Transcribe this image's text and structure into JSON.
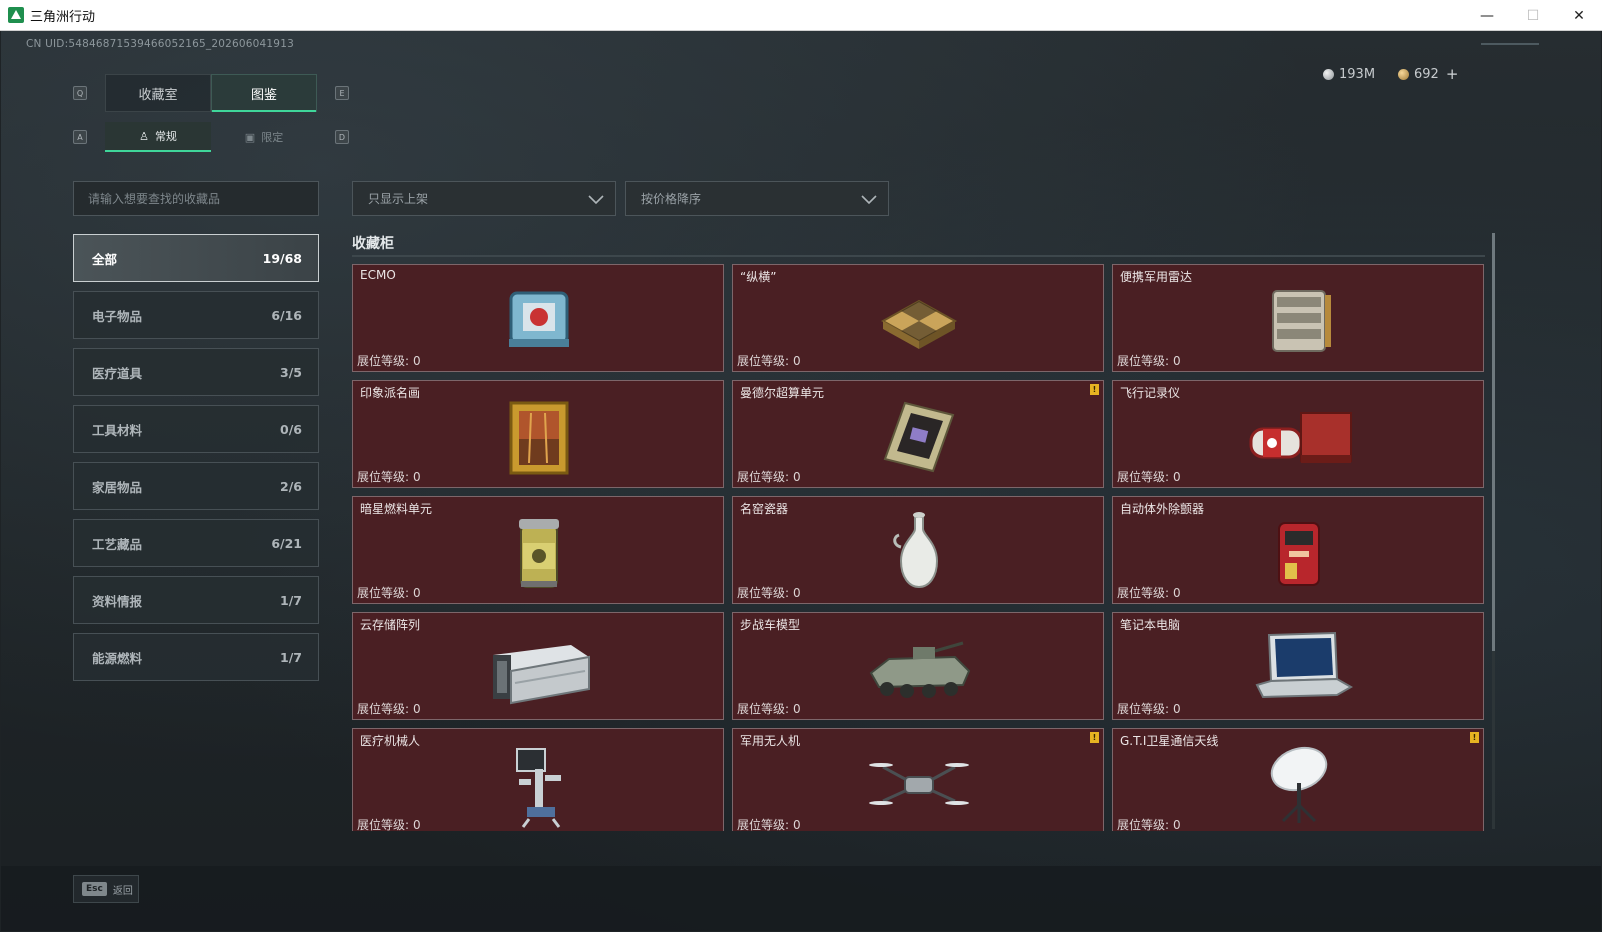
{
  "window": {
    "title": "三角洲行动",
    "minimize": "—",
    "maximize": "☐",
    "close": "✕"
  },
  "uid": "CN UID:5484687153946605216​5_202606041913",
  "currency": {
    "silver": "193M",
    "gold": "692"
  },
  "top_tabs": {
    "key_left": "Q",
    "key_right": "E",
    "items": [
      {
        "label": "收藏室",
        "active": false
      },
      {
        "label": "图鉴",
        "active": true
      }
    ]
  },
  "sub_tabs": {
    "key_left": "A",
    "key_right": "D",
    "items": [
      {
        "label": "常规",
        "icon": "figure-icon",
        "active": true
      },
      {
        "label": "限定",
        "icon": "image-icon",
        "active": false
      }
    ]
  },
  "search": {
    "placeholder": "请输入想要查找的收藏品",
    "value": ""
  },
  "filters": {
    "display": "只显示上架",
    "sort": "按价格降序"
  },
  "categories": [
    {
      "label": "全部",
      "count": "19/68",
      "active": true
    },
    {
      "label": "电子物品",
      "count": "6/16",
      "active": false
    },
    {
      "label": "医疗道具",
      "count": "3/5",
      "active": false
    },
    {
      "label": "工具材料",
      "count": "0/6",
      "active": false
    },
    {
      "label": "家居物品",
      "count": "2/6",
      "active": false
    },
    {
      "label": "工艺藏品",
      "count": "6/21",
      "active": false
    },
    {
      "label": "资料情报",
      "count": "1/7",
      "active": false
    },
    {
      "label": "能源燃料",
      "count": "1/7",
      "active": false
    }
  ],
  "cabinet": {
    "title": "收藏柜",
    "level_label": "展位等级:",
    "items": [
      {
        "name": "ECMO",
        "level": "0",
        "icon": "ecmo-device-icon",
        "flag": false
      },
      {
        "name": "“纵横”",
        "level": "0",
        "icon": "chessboard-icon",
        "flag": false
      },
      {
        "name": "便携军用雷达",
        "level": "0",
        "icon": "portable-radar-icon",
        "flag": false
      },
      {
        "name": "印象派名画",
        "level": "0",
        "icon": "framed-painting-icon",
        "flag": false
      },
      {
        "name": "曼德尔超算单元",
        "level": "0",
        "icon": "supercomputer-unit-icon",
        "flag": true
      },
      {
        "name": "飞行记录仪",
        "level": "0",
        "icon": "flight-recorder-icon",
        "flag": false
      },
      {
        "name": "暗星燃料单元",
        "level": "0",
        "icon": "fuel-cell-icon",
        "flag": false
      },
      {
        "name": "名窑瓷器",
        "level": "0",
        "icon": "porcelain-vase-icon",
        "flag": false
      },
      {
        "name": "自动体外除颤器",
        "level": "0",
        "icon": "defibrillator-icon",
        "flag": false
      },
      {
        "name": "云存储阵列",
        "level": "0",
        "icon": "storage-array-icon",
        "flag": false
      },
      {
        "name": "步战车模型",
        "level": "0",
        "icon": "ifv-model-icon",
        "flag": false
      },
      {
        "name": "笔记本电脑",
        "level": "0",
        "icon": "laptop-icon",
        "flag": false
      },
      {
        "name": "医疗机械人",
        "level": "0",
        "icon": "medical-robot-icon",
        "flag": false
      },
      {
        "name": "军用无人机",
        "level": "0",
        "icon": "drone-icon",
        "flag": true
      },
      {
        "name": "G.T.I卫星通信天线",
        "level": "0",
        "icon": "satellite-dish-icon",
        "flag": true
      }
    ]
  },
  "bottom": {
    "esc_key": "Esc",
    "back_label": "返回"
  },
  "colors": {
    "accent": "#3fd69a",
    "card_bg": "#4a1f23",
    "card_border": "#7d666a",
    "flag": "#e6b422"
  }
}
